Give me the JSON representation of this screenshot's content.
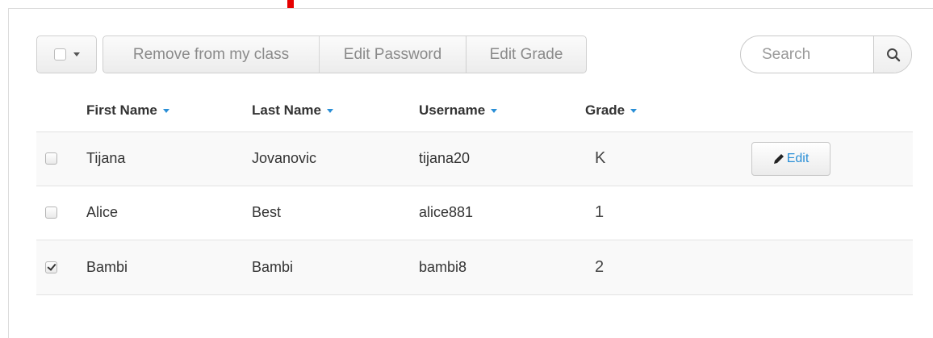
{
  "toolbar": {
    "remove_label": "Remove from my class",
    "edit_password_label": "Edit Password",
    "edit_grade_label": "Edit Grade"
  },
  "search": {
    "placeholder": "Search"
  },
  "table": {
    "headers": {
      "first": "First Name",
      "last": "Last Name",
      "username": "Username",
      "grade": "Grade"
    },
    "rows": [
      {
        "first": "Tijana",
        "last": "Jovanovic",
        "username": "tijana20",
        "grade": "K",
        "checked": false,
        "edit_label": "Edit"
      },
      {
        "first": "Alice",
        "last": "Best",
        "username": "alice881",
        "grade": "1",
        "checked": false
      },
      {
        "first": "Bambi",
        "last": "Bambi",
        "username": "bambi8",
        "grade": "2",
        "checked": true
      }
    ]
  },
  "colors": {
    "accent": "#2a8fd6",
    "arrow": "#e60000"
  }
}
